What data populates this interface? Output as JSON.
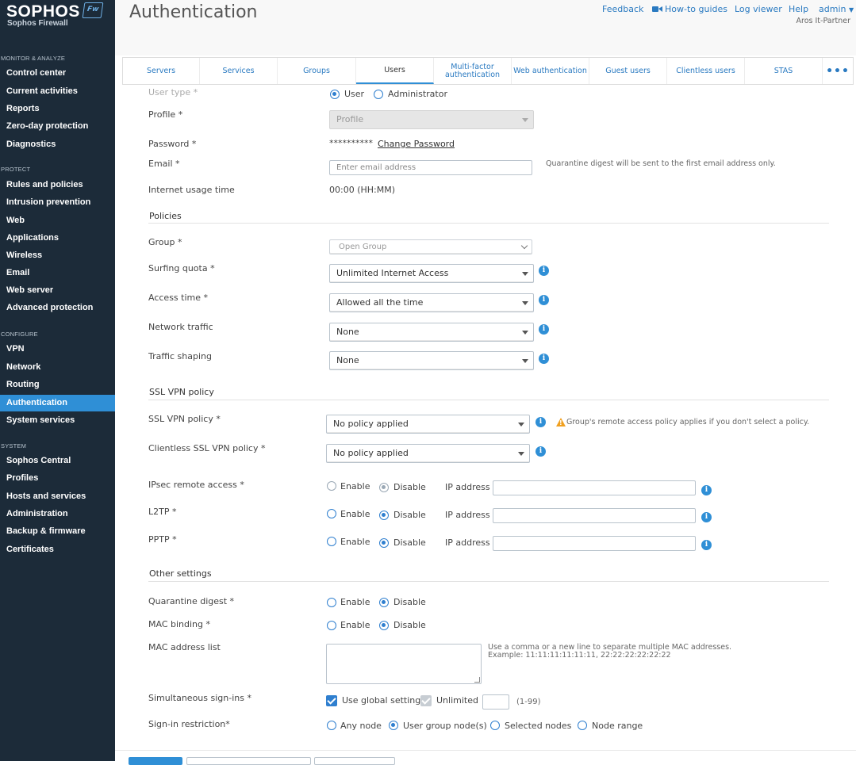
{
  "brand": {
    "name": "SOPHOS",
    "badge": "Fw",
    "product": "Sophos Firewall"
  },
  "sidebar": {
    "sections": [
      {
        "label": "MONITOR & ANALYZE",
        "items": [
          "Control center",
          "Current activities",
          "Reports",
          "Zero-day protection",
          "Diagnostics"
        ]
      },
      {
        "label": "PROTECT",
        "items": [
          "Rules and policies",
          "Intrusion prevention",
          "Web",
          "Applications",
          "Wireless",
          "Email",
          "Web server",
          "Advanced protection"
        ]
      },
      {
        "label": "CONFIGURE",
        "items": [
          "VPN",
          "Network",
          "Routing",
          "Authentication",
          "System services"
        ]
      },
      {
        "label": "SYSTEM",
        "items": [
          "Sophos Central",
          "Profiles",
          "Hosts and services",
          "Administration",
          "Backup & firmware",
          "Certificates"
        ]
      }
    ],
    "active": "Authentication"
  },
  "header": {
    "title": "Authentication",
    "links": {
      "feedback": "Feedback",
      "howto": "How-to guides",
      "logviewer": "Log viewer",
      "help": "Help",
      "admin": "admin"
    },
    "partner": "Aros It-Partner"
  },
  "tabs": [
    "Servers",
    "Services",
    "Groups",
    "Users",
    "Multi-factor authentication",
    "Web authentication",
    "Guest users",
    "Clientless users",
    "STAS"
  ],
  "active_tab": "Users",
  "form": {
    "user_type": {
      "label": "User type *",
      "opt_user": "User",
      "opt_admin": "Administrator"
    },
    "profile": {
      "label": "Profile *",
      "value": "Profile"
    },
    "password": {
      "label": "Password *",
      "value": "**********",
      "change": "Change Password"
    },
    "email": {
      "label": "Email *",
      "placeholder": "Enter email address",
      "hint": "Quarantine digest will be sent to the first email address only."
    },
    "internet_usage": {
      "label": "Internet usage time",
      "value": "00:00 (HH:MM)"
    },
    "policies_title": "Policies",
    "group": {
      "label": "Group *",
      "value": "Open Group"
    },
    "surfing_quota": {
      "label": "Surfing quota *",
      "value": "Unlimited Internet Access"
    },
    "access_time": {
      "label": "Access time *",
      "value": "Allowed all the time"
    },
    "network_traffic": {
      "label": "Network traffic",
      "value": "None"
    },
    "traffic_shaping": {
      "label": "Traffic shaping",
      "value": "None"
    },
    "sslvpn_title": "SSL VPN policy",
    "sslvpn_policy": {
      "label": "SSL VPN policy *",
      "value": "No policy applied",
      "warning": "Group's remote access policy applies if you don't select a policy."
    },
    "clientless_policy": {
      "label": "Clientless SSL VPN policy *",
      "value": "No policy applied"
    },
    "ipsec": {
      "label": "IPsec remote access *",
      "enable": "Enable",
      "disable": "Disable",
      "ip": "IP address"
    },
    "l2tp": {
      "label": "L2TP *",
      "enable": "Enable",
      "disable": "Disable",
      "ip": "IP address"
    },
    "pptp": {
      "label": "PPTP *",
      "enable": "Enable",
      "disable": "Disable",
      "ip": "IP address"
    },
    "other_title": "Other settings",
    "quarantine": {
      "label": "Quarantine digest *",
      "enable": "Enable",
      "disable": "Disable"
    },
    "mac_binding": {
      "label": "MAC binding *",
      "enable": "Enable",
      "disable": "Disable"
    },
    "mac_list": {
      "label": "MAC address list",
      "hint1": "Use a comma or a new line to separate multiple MAC addresses.",
      "hint2": "Example: 11:11:11:11:11:11, 22:22:22:22:22:22"
    },
    "simultaneous": {
      "label": "Simultaneous sign-ins *",
      "global": "Use global setting",
      "unlimited": "Unlimited",
      "range": "(1-99)"
    },
    "signin_restriction": {
      "label": "Sign-in restriction*",
      "any": "Any node",
      "user_group": "User group node(s)",
      "selected": "Selected nodes",
      "range": "Node range"
    }
  }
}
